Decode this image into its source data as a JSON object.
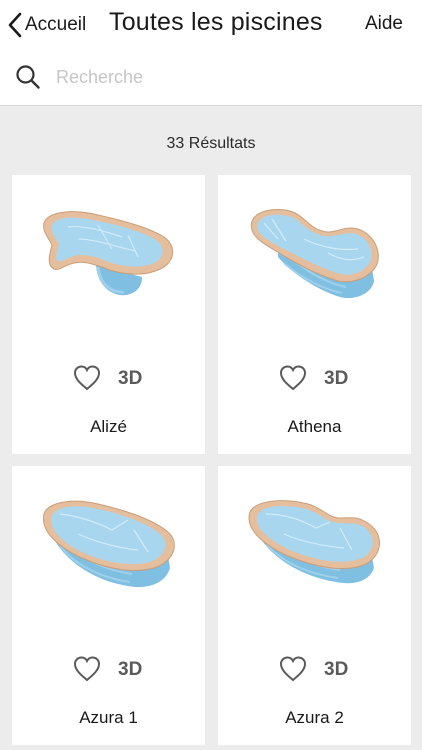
{
  "header": {
    "back_label": "Accueil",
    "title": "Toutes les piscines",
    "help_label": "Aide"
  },
  "search": {
    "placeholder": "Recherche"
  },
  "results": {
    "count_label": "33 Résultats"
  },
  "pools": [
    {
      "name": "Alizé",
      "badge": "3D",
      "shape": "kidney"
    },
    {
      "name": "Athena",
      "badge": "3D",
      "shape": "kidney-deep"
    },
    {
      "name": "Azura 1",
      "badge": "3D",
      "shape": "oval"
    },
    {
      "name": "Azura 2",
      "badge": "3D",
      "shape": "roman-oval"
    }
  ],
  "colors": {
    "background": "#ececec",
    "card": "#ffffff",
    "coping": "#e5bf9d",
    "water": "#a8d6ef",
    "water_dark": "#7fbfe2",
    "icon": "#5a5a5a"
  }
}
